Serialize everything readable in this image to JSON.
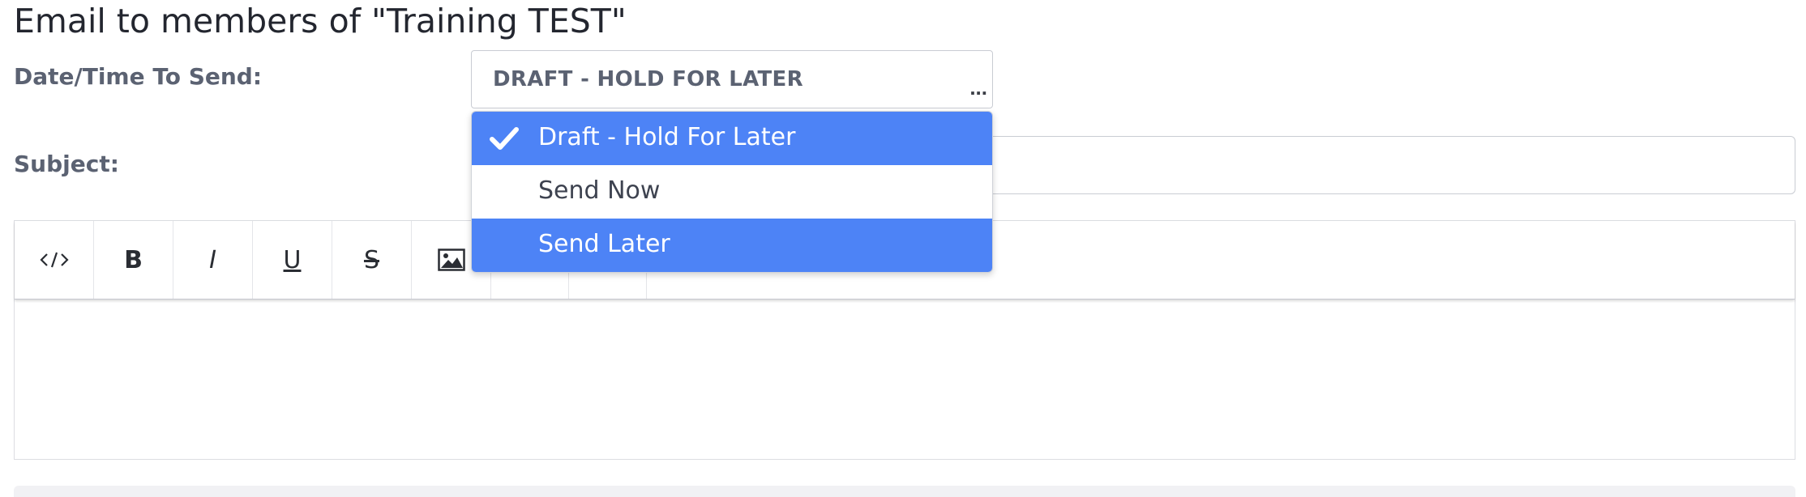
{
  "page_title": "Email to members of \"Training TEST\"",
  "form": {
    "date_label": "Date/Time To Send:",
    "subject_label": "Subject:",
    "select_value": "DRAFT - HOLD FOR LATER",
    "select_ellipsis": "...",
    "subject_value": ""
  },
  "dropdown": {
    "options": [
      {
        "label": "Draft - Hold For Later",
        "selected": true,
        "highlighted": true
      },
      {
        "label": "Send Now",
        "selected": false,
        "highlighted": false
      },
      {
        "label": "Send Later",
        "selected": false,
        "highlighted": true
      }
    ]
  },
  "toolbar": {
    "buttons": [
      {
        "name": "code-view",
        "glyph": "</>"
      },
      {
        "name": "bold",
        "glyph": "B"
      },
      {
        "name": "italic",
        "glyph": "I"
      },
      {
        "name": "underline",
        "glyph": "U"
      },
      {
        "name": "strikethrough",
        "glyph": "S"
      },
      {
        "name": "image",
        "glyph": ""
      },
      {
        "name": "hidden-1",
        "glyph": ""
      },
      {
        "name": "hidden-2",
        "glyph": ""
      }
    ]
  },
  "colors": {
    "accent": "#4d83f6",
    "label": "#5b6272",
    "border": "#c9ccd3"
  }
}
